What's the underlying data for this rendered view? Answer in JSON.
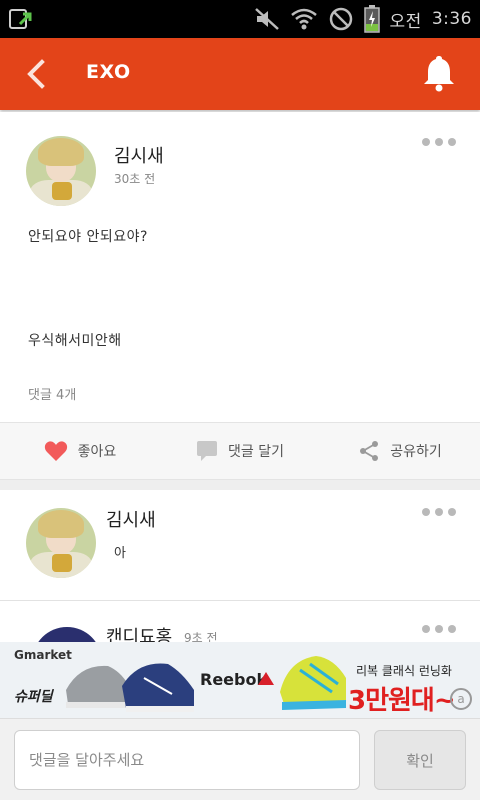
{
  "status_bar": {
    "ampm": "오전",
    "time": "3:36",
    "icons": [
      "download-icon",
      "mute-icon",
      "wifi-icon",
      "no-signal-icon",
      "battery-charging-icon"
    ]
  },
  "app_bar": {
    "title": "EXO",
    "back_icon": "back-chevron-icon",
    "notification_icon": "bell-icon",
    "color": "#e34419"
  },
  "post": {
    "author": "김시새",
    "time_ago": "30초 전",
    "text_line1": "안되요야 안되요야?",
    "text_line2": "우식해서미안해",
    "comment_count": "댓글 4개"
  },
  "actions": {
    "like_label": "좋아요",
    "comment_label": "댓글 달기",
    "share_label": "공유하기",
    "like_color": "#f25a5a"
  },
  "comments": [
    {
      "author": "김시새",
      "time_ago": "",
      "text": "아"
    },
    {
      "author": "캔디됴홍",
      "time_ago": "9초 전",
      "text": ""
    }
  ],
  "ad": {
    "brand_a": "Gmarket",
    "brand_b": "슈퍼딜",
    "brand_c": "Reebok",
    "headline": "리복 클래식 런닝화",
    "price": "3만원대~"
  },
  "input_bar": {
    "placeholder": "댓글을 달아주세요",
    "confirm_label": "확인"
  }
}
